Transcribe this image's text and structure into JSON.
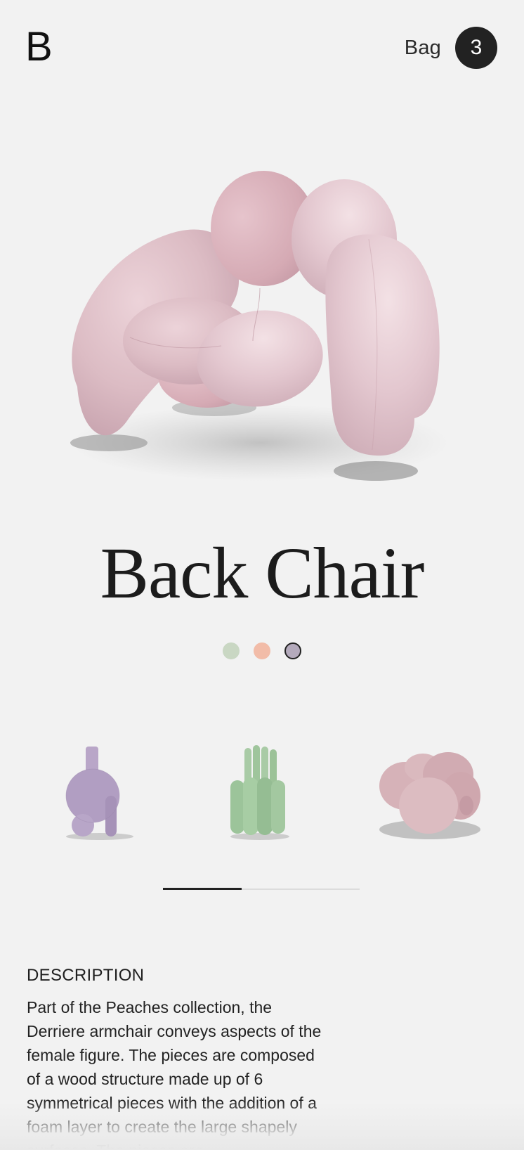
{
  "header": {
    "logo": "B",
    "bag_label": "Bag",
    "bag_count": "3"
  },
  "product": {
    "title": "Back Chair",
    "swatches": [
      {
        "color": "#c9d7c3",
        "selected": false
      },
      {
        "color": "#f2bca8",
        "selected": false
      },
      {
        "color": "#b4aabc",
        "selected": true
      }
    ]
  },
  "related": {
    "items": [
      {
        "icon": "lilac-vase-sculpture",
        "color": "#b5a2c4"
      },
      {
        "icon": "green-vase-sculpture",
        "color": "#9cc39a"
      },
      {
        "icon": "pink-pouf",
        "color": "#d8b4b8"
      }
    ],
    "scroll_progress": 0.4
  },
  "description": {
    "heading": "DESCRIPTION",
    "body": "Part of the Peaches collection, the Derriere armchair conveys aspects of the female figure. The pieces are composed of a wood structure made up of 6 symmetrical pieces with the addition of a foam layer to create the large shapely surfaces. The pieces are"
  }
}
